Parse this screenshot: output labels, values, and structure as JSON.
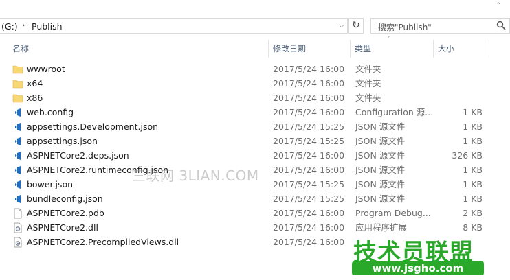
{
  "address": {
    "drive": "(G:)",
    "crumb": "Publish"
  },
  "search": {
    "placeholder": "搜索\"Publish\""
  },
  "columns": {
    "name": "名称",
    "date": "修改日期",
    "type": "类型",
    "size": "大小"
  },
  "files": [
    {
      "name": "wwwroot",
      "date": "2017/5/24 16:00",
      "type": "文件夹",
      "size": "",
      "icon": "folder-icon"
    },
    {
      "name": "x64",
      "date": "2017/5/24 16:00",
      "type": "文件夹",
      "size": "",
      "icon": "folder-icon"
    },
    {
      "name": "x86",
      "date": "2017/5/24 16:00",
      "type": "文件夹",
      "size": "",
      "icon": "folder-icon"
    },
    {
      "name": "web.config",
      "date": "2017/5/24 16:00",
      "type": "Configuration 源...",
      "size": "1 KB",
      "icon": "vs-file-icon"
    },
    {
      "name": "appsettings.Development.json",
      "date": "2017/5/24 15:25",
      "type": "JSON 源文件",
      "size": "1 KB",
      "icon": "vs-file-icon"
    },
    {
      "name": "appsettings.json",
      "date": "2017/5/24 15:25",
      "type": "JSON 源文件",
      "size": "1 KB",
      "icon": "vs-file-icon"
    },
    {
      "name": "ASPNETCore2.deps.json",
      "date": "2017/5/24 16:00",
      "type": "JSON 源文件",
      "size": "326 KB",
      "icon": "vs-file-icon"
    },
    {
      "name": "ASPNETCore2.runtimeconfig.json",
      "date": "2017/5/24 16:00",
      "type": "JSON 源文件",
      "size": "1 KB",
      "icon": "vs-file-icon"
    },
    {
      "name": "bower.json",
      "date": "2017/5/24 15:25",
      "type": "JSON 源文件",
      "size": "1 KB",
      "icon": "vs-file-icon"
    },
    {
      "name": "bundleconfig.json",
      "date": "2017/5/24 15:25",
      "type": "JSON 源文件",
      "size": "1 KB",
      "icon": "vs-file-icon"
    },
    {
      "name": "ASPNETCore2.pdb",
      "date": "2017/5/24 16:00",
      "type": "Program Debug...",
      "size": "2 KB",
      "icon": "blank-file-icon"
    },
    {
      "name": "ASPNETCore2.dll",
      "date": "2017/5/24 16:00",
      "type": "应用程序扩展",
      "size": "8 KB",
      "icon": "dll-file-icon"
    },
    {
      "name": "ASPNETCore2.PrecompiledViews.dll",
      "date": "2017/5/24 16:00",
      "type": "",
      "size": "",
      "icon": "dll-file-icon"
    }
  ],
  "watermark": {
    "text": "三联网 3LIAN.COM",
    "brand": "技术员联盟",
    "brand_url": "www.jsgho.com"
  },
  "colors": {
    "folder": "#f8d775",
    "vs_blue": "#1e6fc4",
    "brand_green": "#2aa82a"
  }
}
